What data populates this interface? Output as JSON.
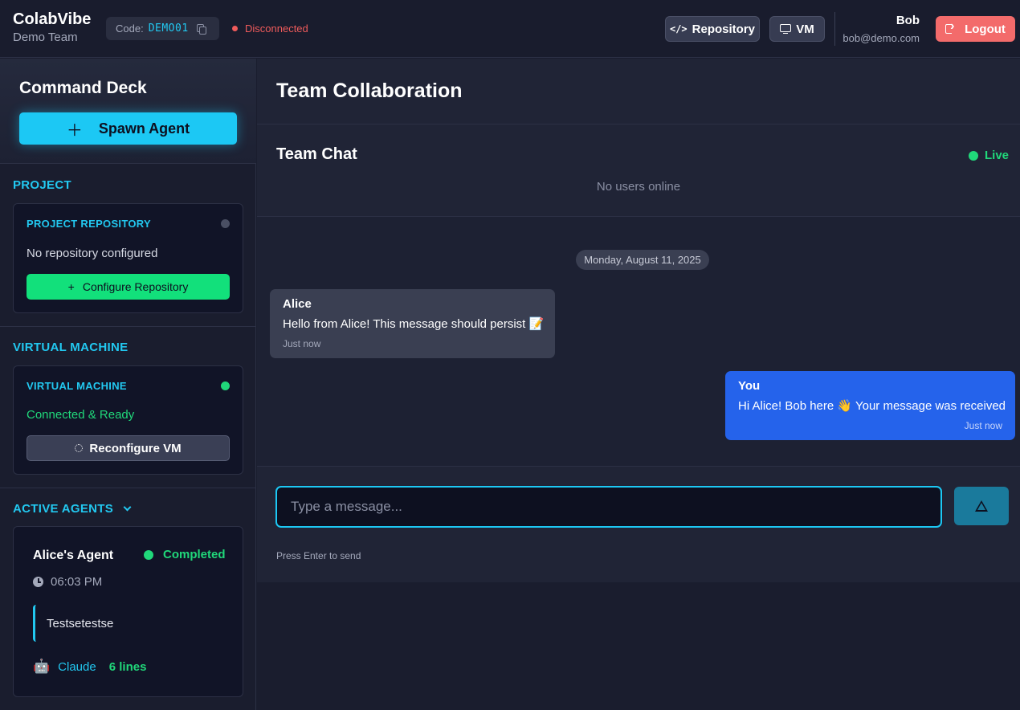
{
  "header": {
    "brand_title": "ColabVibe",
    "team_name": "Demo Team",
    "code_label": "Code:",
    "code_value": "DEMO01",
    "connection_status": "Disconnected",
    "repo_button": "Repository",
    "vm_button": "VM",
    "user_name": "Bob",
    "user_email": "bob@demo.com",
    "logout_button": "Logout"
  },
  "sidebar": {
    "deck_title": "Command Deck",
    "spawn_button": "Spawn Agent",
    "project": {
      "section_title": "PROJECT",
      "card_title": "PROJECT REPOSITORY",
      "status_text": "No repository configured",
      "configure_button": "Configure Repository"
    },
    "vm": {
      "section_title": "VIRTUAL MACHINE",
      "card_title": "VIRTUAL MACHINE",
      "status_text": "Connected & Ready",
      "reconfigure_button": "Reconfigure VM"
    },
    "agents": {
      "section_title": "ACTIVE AGENTS",
      "items": [
        {
          "name": "Alice's Agent",
          "status": "Completed",
          "time": "06:03 PM",
          "task": "Testsetestse",
          "model": "Claude",
          "lines": "6 lines"
        }
      ]
    }
  },
  "main": {
    "title": "Team Collaboration",
    "chat": {
      "title": "Team Chat",
      "live_label": "Live",
      "online_text": "No users online",
      "date_separator": "Monday, August 11, 2025",
      "messages": [
        {
          "author": "Alice",
          "text": "Hello from Alice! This message should persist 📝",
          "time": "Just now",
          "direction": "incoming"
        },
        {
          "author": "You",
          "text": "Hi Alice! Bob here 👋 Your message was received",
          "time": "Just now",
          "direction": "outgoing"
        }
      ],
      "input_placeholder": "Type a message...",
      "input_value": "",
      "hint": "Press Enter to send"
    }
  },
  "colors": {
    "accent_cyan": "#1cc8f4",
    "success_green": "#20d87a",
    "danger_red": "#f36b6b",
    "outgoing_bubble": "#2563eb",
    "inactive_dot": "#4a4f63"
  }
}
